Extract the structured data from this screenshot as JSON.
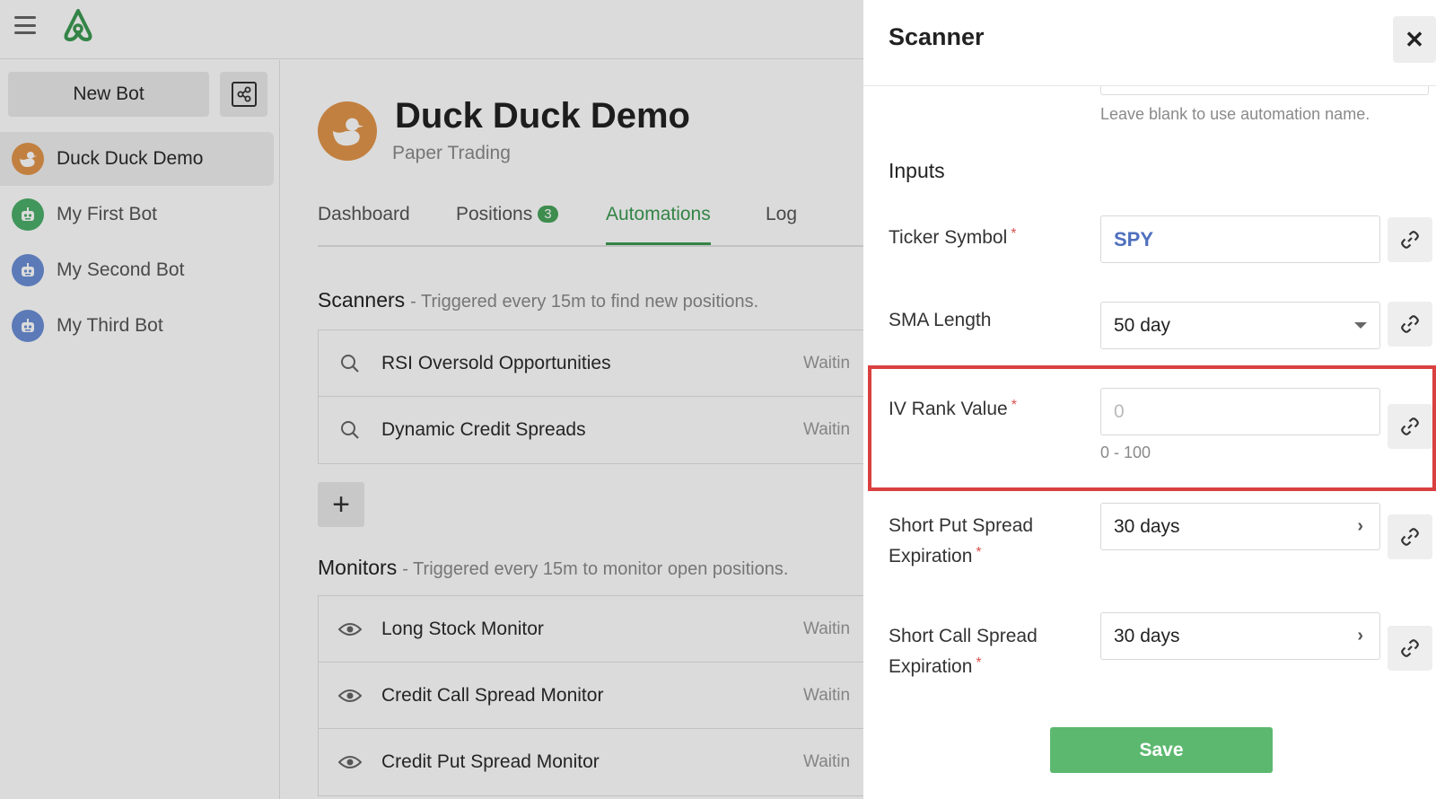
{
  "app": {
    "new_bot_label": "New Bot",
    "bots": [
      {
        "name": "Duck Duck Demo",
        "active": true,
        "avatar_color": "#e2954b"
      },
      {
        "name": "My First Bot",
        "active": false,
        "avatar_color": "#4caf6a"
      },
      {
        "name": "My Second Bot",
        "active": false,
        "avatar_color": "#6b8fd6"
      },
      {
        "name": "My Third Bot",
        "active": false,
        "avatar_color": "#6b8fd6"
      }
    ]
  },
  "header": {
    "title": "Duck Duck Demo",
    "subtitle": "Paper Trading"
  },
  "tabs": [
    {
      "label": "Dashboard"
    },
    {
      "label": "Positions",
      "badge": "3"
    },
    {
      "label": "Automations",
      "active": true
    },
    {
      "label": "Log"
    }
  ],
  "scanners": {
    "title": "Scanners",
    "desc": "- Triggered every 15m to find new positions.",
    "items": [
      {
        "name": "RSI Oversold Opportunities",
        "status": "Waitin"
      },
      {
        "name": "Dynamic Credit Spreads",
        "status": "Waitin"
      }
    ]
  },
  "monitors": {
    "title": "Monitors",
    "desc": "- Triggered every 15m to monitor open positions.",
    "items": [
      {
        "name": "Long Stock Monitor",
        "status": "Waitin"
      },
      {
        "name": "Credit Call Spread Monitor",
        "status": "Waitin"
      },
      {
        "name": "Credit Put Spread Monitor",
        "status": "Waitin"
      }
    ]
  },
  "drawer": {
    "title": "Scanner",
    "name_hint": "Leave blank to use automation name.",
    "inputs_title": "Inputs",
    "fields": {
      "ticker": {
        "label": "Ticker Symbol",
        "required": "*",
        "value": "SPY"
      },
      "sma": {
        "label": "SMA Length",
        "value": "50 day"
      },
      "iv_rank": {
        "label": "IV Rank Value",
        "required": "*",
        "placeholder": "0",
        "range": "0 - 100"
      },
      "short_put": {
        "label_line1": "Short Put Spread",
        "label_line2": "Expiration",
        "required": "*",
        "value": "30 days"
      },
      "short_call": {
        "label_line1": "Short Call Spread",
        "label_line2": "Expiration",
        "required": "*",
        "value": "30 days"
      }
    },
    "save_label": "Save"
  },
  "colors": {
    "accent_green": "#3c9a52",
    "save_green": "#5cb86f",
    "highlight_red": "#d94040",
    "ticker_blue": "#4f6fbe"
  }
}
